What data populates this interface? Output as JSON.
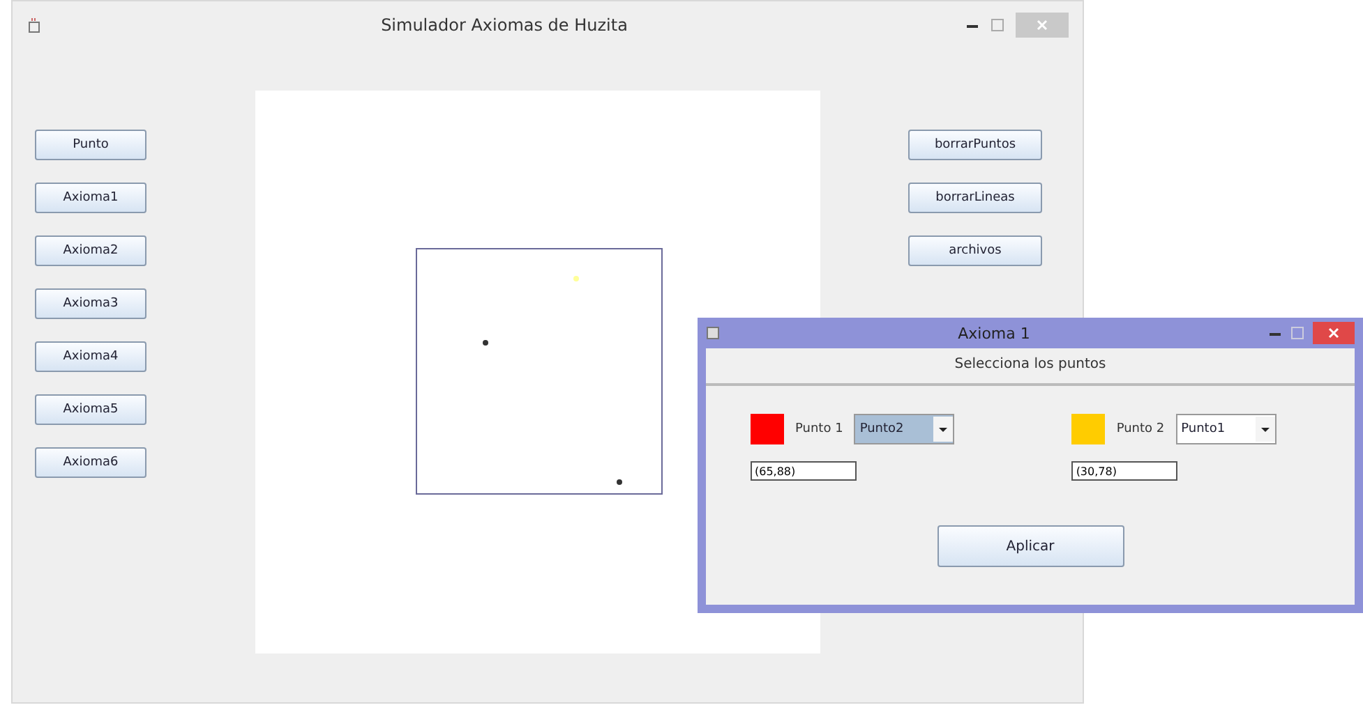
{
  "window": {
    "title": "Simulador Axiomas de Huzita"
  },
  "left_buttons": [
    "Punto",
    "Axioma1",
    "Axioma2",
    "Axioma3",
    "Axioma4",
    "Axioma5",
    "Axioma6"
  ],
  "right_buttons": [
    "borrarPuntos",
    "borrarLineas",
    "archivos"
  ],
  "canvas": {
    "points": [
      {
        "color": "#ffff99"
      },
      {
        "color": "#333333"
      },
      {
        "color": "#333333"
      }
    ]
  },
  "dialog": {
    "title": "Axioma 1",
    "heading": "Selecciona los puntos",
    "apply": "Aplicar",
    "points": [
      {
        "label": "Punto 1",
        "color": "#ff0000",
        "choice": "Punto2",
        "focused": true,
        "value": "(65,88)"
      },
      {
        "label": "Punto 2",
        "color": "#ffcc00",
        "choice": "Punto1",
        "focused": false,
        "value": "(30,78)"
      }
    ]
  }
}
